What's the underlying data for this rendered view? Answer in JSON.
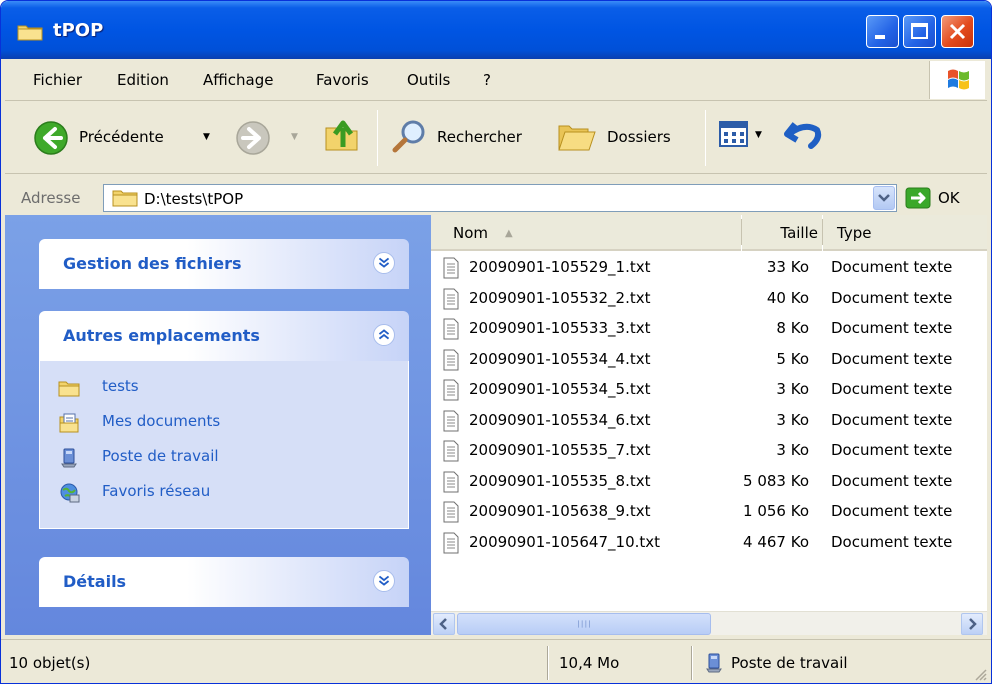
{
  "window": {
    "title": "tPOP",
    "colors": {
      "titlebar": "#0055e3",
      "close": "#e34a1c",
      "task_pane": "#6f95e2",
      "link": "#215dc6"
    }
  },
  "menu": {
    "items": [
      "Fichier",
      "Edition",
      "Affichage",
      "Favoris",
      "Outils",
      "?"
    ]
  },
  "toolbar": {
    "back_label": "Précédente",
    "search_label": "Rechercher",
    "folders_label": "Dossiers"
  },
  "address": {
    "label": "Adresse",
    "value": "D:\\tests\\tPOP",
    "go_label": "OK"
  },
  "task_pane": {
    "file_tasks": {
      "title": "Gestion des fichiers",
      "state": "collapsed"
    },
    "other_places": {
      "title": "Autres emplacements",
      "state": "expanded",
      "links": [
        {
          "label": "tests",
          "icon": "folder-icon"
        },
        {
          "label": "Mes documents",
          "icon": "my-documents-icon"
        },
        {
          "label": "Poste de travail",
          "icon": "my-computer-icon"
        },
        {
          "label": "Favoris réseau",
          "icon": "network-places-icon"
        }
      ]
    },
    "details": {
      "title": "Détails",
      "state": "collapsed"
    }
  },
  "files": {
    "columns": {
      "name": "Nom",
      "size": "Taille",
      "type": "Type"
    },
    "sort": {
      "column": "name",
      "direction": "ascending"
    },
    "rows": [
      {
        "name": "20090901-105529_1.txt",
        "size": "33 Ko",
        "type": "Document texte"
      },
      {
        "name": "20090901-105532_2.txt",
        "size": "40 Ko",
        "type": "Document texte"
      },
      {
        "name": "20090901-105533_3.txt",
        "size": "8 Ko",
        "type": "Document texte"
      },
      {
        "name": "20090901-105534_4.txt",
        "size": "5 Ko",
        "type": "Document texte"
      },
      {
        "name": "20090901-105534_5.txt",
        "size": "3 Ko",
        "type": "Document texte"
      },
      {
        "name": "20090901-105534_6.txt",
        "size": "3 Ko",
        "type": "Document texte"
      },
      {
        "name": "20090901-105535_7.txt",
        "size": "3 Ko",
        "type": "Document texte"
      },
      {
        "name": "20090901-105535_8.txt",
        "size": "5 083 Ko",
        "type": "Document texte"
      },
      {
        "name": "20090901-105638_9.txt",
        "size": "1 056 Ko",
        "type": "Document texte"
      },
      {
        "name": "20090901-105647_10.txt",
        "size": "4 467 Ko",
        "type": "Document texte"
      }
    ]
  },
  "status": {
    "count": "10 objet(s)",
    "total_size": "10,4 Mo",
    "zone": "Poste de travail"
  }
}
